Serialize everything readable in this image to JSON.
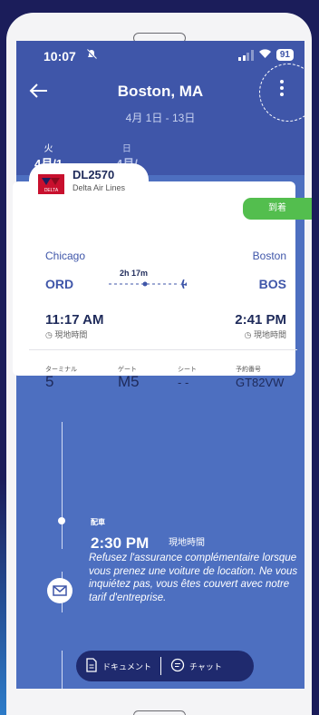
{
  "status": {
    "time": "10:07",
    "battery": "91"
  },
  "header": {
    "title": "Boston, MA",
    "dates": "4月 1日 - 13日"
  },
  "day_tabs": [
    {
      "weekday": "火",
      "date": "4月/1"
    },
    {
      "weekday": "日",
      "date": "4月/"
    }
  ],
  "flight": {
    "number": "DL2570",
    "airline": "Delta Air Lines",
    "logo_text": "DELTA",
    "status": "到着",
    "origin_city": "Chicago",
    "dest_city": "Boston",
    "origin_code": "ORD",
    "dest_code": "BOS",
    "duration": "2h 17m",
    "depart_time": "11:17 AM",
    "arrive_time": "2:41 PM",
    "local_time_label": "現地時間",
    "terminal_label": "ターミナル",
    "terminal": "5",
    "gate_label": "ゲート",
    "gate": "M5",
    "seat_label": "シート",
    "seat": "- -",
    "confirmation_label": "予約番号",
    "confirmation": "GT82VW"
  },
  "pickup": {
    "label": "配車",
    "time": "2:30 PM",
    "local": "現地時間"
  },
  "note": "Refusez l'assurance complémentaire lorsque vous prenez une voiture de location.  Ne vous inquiétez pas, vous êtes couvert avec notre tarif d'entreprise.",
  "actions": {
    "documents": "ドキュメント",
    "chat": "チャット"
  },
  "colors": {
    "header": "#3f56a9",
    "body": "#4d6fc0",
    "arrived": "#53be4e",
    "accent": "#3f56a9"
  },
  "icons": [
    "bell-off-icon",
    "signal-icon",
    "wifi-icon",
    "back-arrow-icon",
    "more-vertical-icon",
    "plane-icon",
    "clock-icon",
    "mail-icon",
    "document-icon",
    "chat-icon"
  ]
}
